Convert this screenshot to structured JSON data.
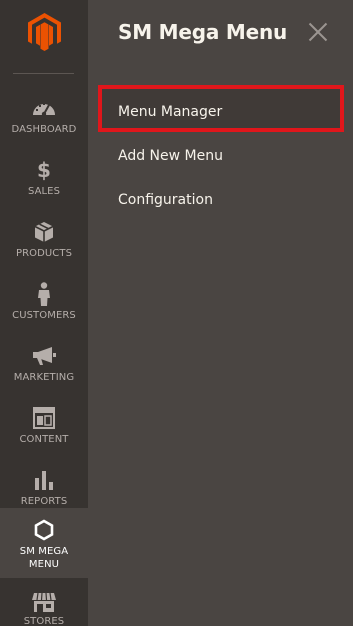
{
  "sidebar": {
    "logo": "magento-logo",
    "items": [
      {
        "label": "DASHBOARD",
        "icon": "dashboard-gauge-icon"
      },
      {
        "label": "SALES",
        "icon": "dollar-icon"
      },
      {
        "label": "PRODUCTS",
        "icon": "box-icon"
      },
      {
        "label": "CUSTOMERS",
        "icon": "person-icon"
      },
      {
        "label": "MARKETING",
        "icon": "megaphone-icon"
      },
      {
        "label": "CONTENT",
        "icon": "layout-icon"
      },
      {
        "label": "REPORTS",
        "icon": "bar-chart-icon"
      },
      {
        "label": "SM MEGA",
        "label2": "MENU",
        "icon": "hexagon-icon",
        "active": true
      },
      {
        "label": "STORES",
        "icon": "storefront-icon"
      }
    ]
  },
  "flyout": {
    "title": "SM Mega Menu",
    "close_icon": "close-icon",
    "items": [
      {
        "label": "Menu Manager",
        "highlighted": true
      },
      {
        "label": "Add New Menu"
      },
      {
        "label": "Configuration"
      }
    ]
  },
  "colors": {
    "sidebar_bg": "#373330",
    "flyout_bg": "#4a4542",
    "logo_orange": "#eb5202",
    "highlight_border": "#e0161b",
    "text_light": "#f7f3eb",
    "nav_text": "#b5aeaa"
  }
}
